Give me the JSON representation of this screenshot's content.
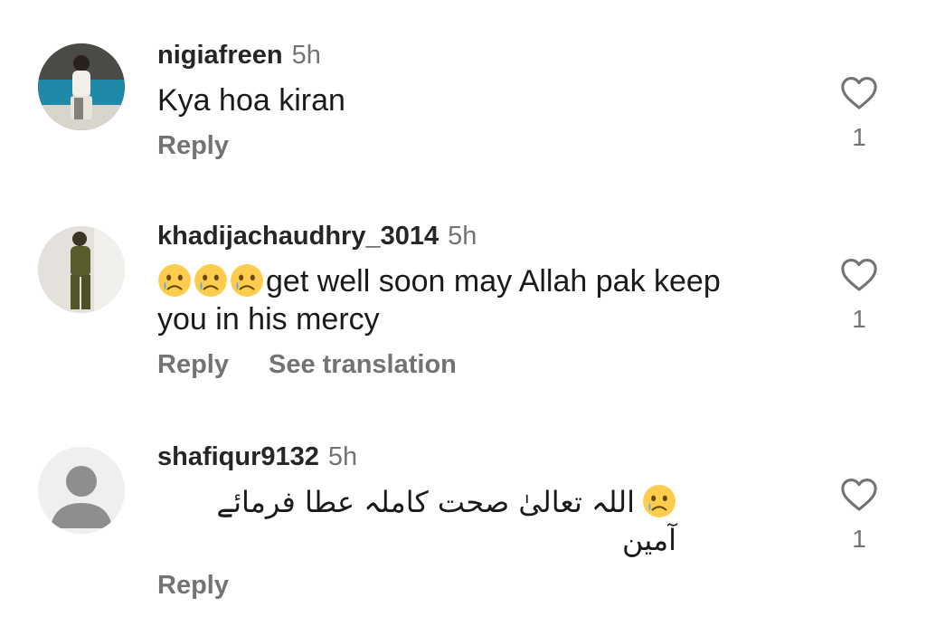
{
  "comments": [
    {
      "username": "nigiafreen",
      "time": "5h",
      "text": "Kya hoa kiran",
      "emoji_prefix": [],
      "reply_label": "Reply",
      "likes": "1"
    },
    {
      "username": "khadijachaudhry_3014",
      "time": "5h",
      "emoji_prefix": [
        "crying-face",
        "crying-face",
        "crying-face"
      ],
      "text": "get well soon may Allah pak keep you in his mercy",
      "reply_label": "Reply",
      "translation_label": "See translation",
      "likes": "1"
    },
    {
      "username": "shafiqur9132",
      "time": "5h",
      "emoji_prefix": [
        "crying-face"
      ],
      "text": "اللہ تعالیٰ صحت کاملہ عطا فرمائے آمین",
      "reply_label": "Reply",
      "likes": "1"
    }
  ],
  "icons": {
    "like": "heart-outline-icon",
    "default_avatar": "default-user-avatar-icon"
  },
  "colors": {
    "text_primary": "#262626",
    "text_secondary": "#737373",
    "background": "#ffffff"
  }
}
